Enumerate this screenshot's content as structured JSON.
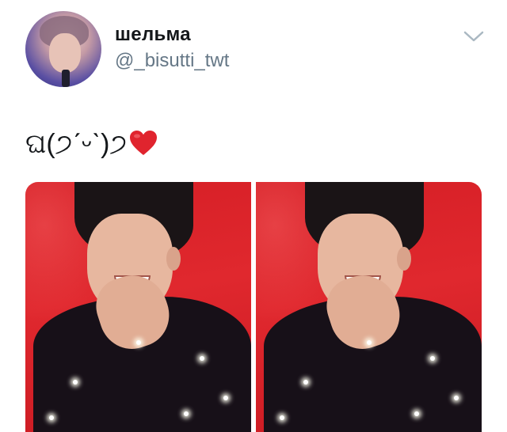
{
  "author": {
    "display_name": "шельма",
    "handle": "@_bisutti_twt"
  },
  "tweet": {
    "text": "ଘ(੭ˊᵕˋ)੭"
  },
  "icons": {
    "menu": "chevron-down-icon",
    "heart": "red-heart-emoji"
  },
  "colors": {
    "handle_gray": "#657786",
    "text": "#14171a",
    "photo_background_red": "#d61f26",
    "heart_red": "#e0242e"
  }
}
